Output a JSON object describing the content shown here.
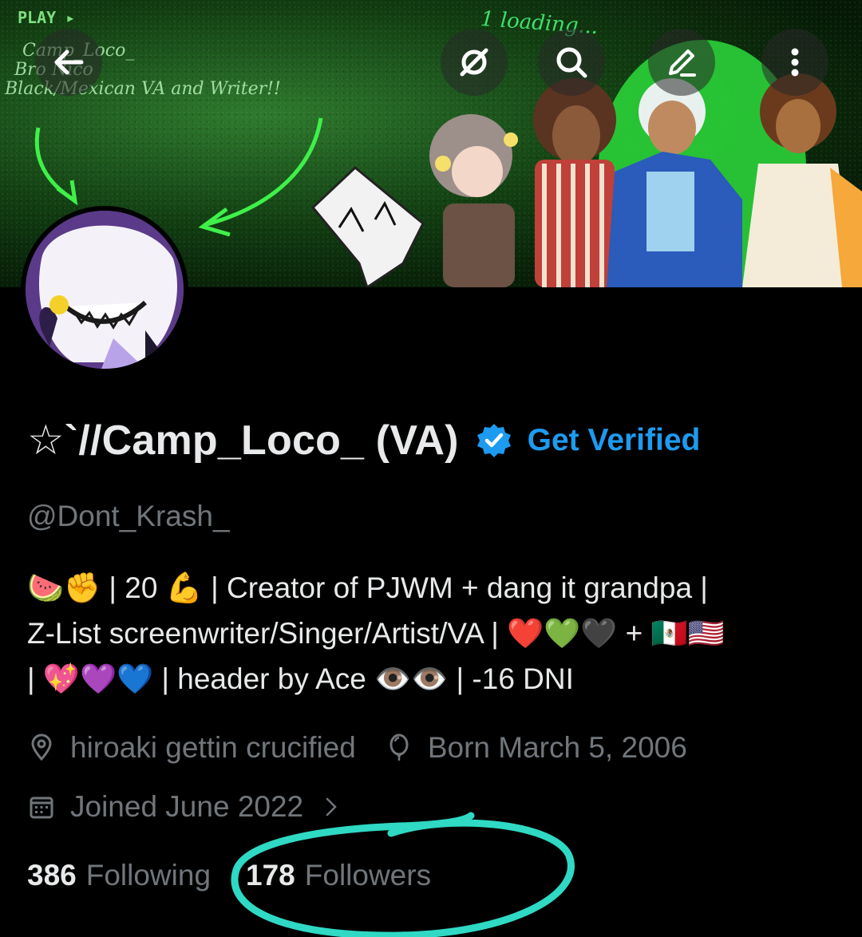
{
  "banner": {
    "play_text": "PLAY ▸",
    "lines": [
      "Camp_Loco_",
      "Bro Nico",
      "Black/Mexican VA and Writer!!"
    ],
    "loading_text": "1 loading..."
  },
  "header_buttons": [
    {
      "icon": "back-arrow-icon"
    },
    {
      "icon": "grok-icon"
    },
    {
      "icon": "search-icon"
    },
    {
      "icon": "edit-icon"
    },
    {
      "icon": "more-vertical-icon"
    }
  ],
  "profile": {
    "display_name": "☆`//Camp_Loco_ (VA)",
    "get_verified": "Get Verified",
    "handle": "@Dont_Krash_",
    "bio_lines": [
      "🍉✊ | 20 💪 | Creator of PJWM + dang it grandpa |",
      "Z-List screenwriter/Singer/Artist/VA | ❤️💚🖤 + 🇲🇽🇺🇸",
      "| 💖💜💙 | header by Ace 👁️👁️ | -16 DNI"
    ],
    "location": "hiroaki gettin crucified",
    "birthday": "Born March 5, 2006",
    "joined": "Joined June 2022",
    "following_count": "386",
    "following_label": "Following",
    "followers_count": "178",
    "followers_label": "Followers"
  },
  "colors": {
    "accent": "#1d9bf0",
    "muted_text": "#71767b",
    "primary_text": "#e7e9ea",
    "background": "#000000",
    "highlight_circle": "#2fd9c4"
  }
}
